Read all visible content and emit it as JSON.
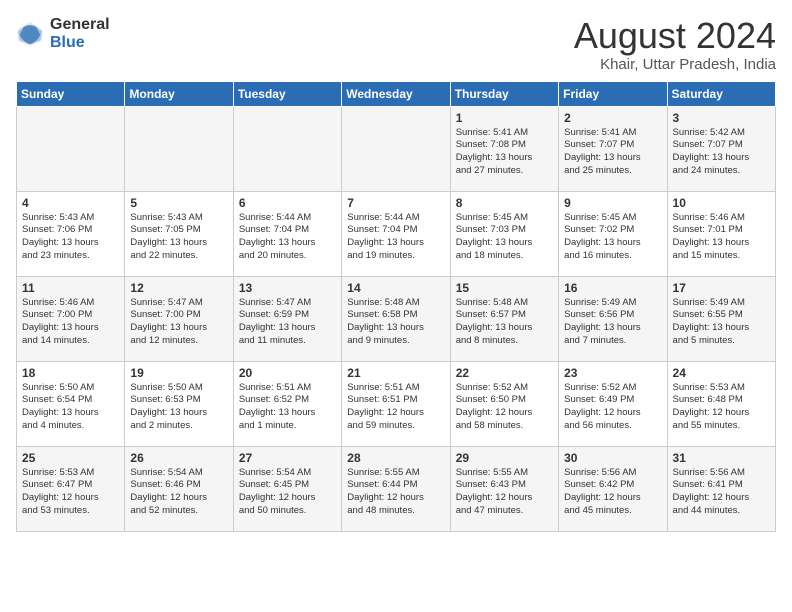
{
  "header": {
    "logo_general": "General",
    "logo_blue": "Blue",
    "month_year": "August 2024",
    "location": "Khair, Uttar Pradesh, India"
  },
  "days_of_week": [
    "Sunday",
    "Monday",
    "Tuesday",
    "Wednesday",
    "Thursday",
    "Friday",
    "Saturday"
  ],
  "weeks": [
    [
      {
        "day": "",
        "text": ""
      },
      {
        "day": "",
        "text": ""
      },
      {
        "day": "",
        "text": ""
      },
      {
        "day": "",
        "text": ""
      },
      {
        "day": "1",
        "text": "Sunrise: 5:41 AM\nSunset: 7:08 PM\nDaylight: 13 hours\nand 27 minutes."
      },
      {
        "day": "2",
        "text": "Sunrise: 5:41 AM\nSunset: 7:07 PM\nDaylight: 13 hours\nand 25 minutes."
      },
      {
        "day": "3",
        "text": "Sunrise: 5:42 AM\nSunset: 7:07 PM\nDaylight: 13 hours\nand 24 minutes."
      }
    ],
    [
      {
        "day": "4",
        "text": "Sunrise: 5:43 AM\nSunset: 7:06 PM\nDaylight: 13 hours\nand 23 minutes."
      },
      {
        "day": "5",
        "text": "Sunrise: 5:43 AM\nSunset: 7:05 PM\nDaylight: 13 hours\nand 22 minutes."
      },
      {
        "day": "6",
        "text": "Sunrise: 5:44 AM\nSunset: 7:04 PM\nDaylight: 13 hours\nand 20 minutes."
      },
      {
        "day": "7",
        "text": "Sunrise: 5:44 AM\nSunset: 7:04 PM\nDaylight: 13 hours\nand 19 minutes."
      },
      {
        "day": "8",
        "text": "Sunrise: 5:45 AM\nSunset: 7:03 PM\nDaylight: 13 hours\nand 18 minutes."
      },
      {
        "day": "9",
        "text": "Sunrise: 5:45 AM\nSunset: 7:02 PM\nDaylight: 13 hours\nand 16 minutes."
      },
      {
        "day": "10",
        "text": "Sunrise: 5:46 AM\nSunset: 7:01 PM\nDaylight: 13 hours\nand 15 minutes."
      }
    ],
    [
      {
        "day": "11",
        "text": "Sunrise: 5:46 AM\nSunset: 7:00 PM\nDaylight: 13 hours\nand 14 minutes."
      },
      {
        "day": "12",
        "text": "Sunrise: 5:47 AM\nSunset: 7:00 PM\nDaylight: 13 hours\nand 12 minutes."
      },
      {
        "day": "13",
        "text": "Sunrise: 5:47 AM\nSunset: 6:59 PM\nDaylight: 13 hours\nand 11 minutes."
      },
      {
        "day": "14",
        "text": "Sunrise: 5:48 AM\nSunset: 6:58 PM\nDaylight: 13 hours\nand 9 minutes."
      },
      {
        "day": "15",
        "text": "Sunrise: 5:48 AM\nSunset: 6:57 PM\nDaylight: 13 hours\nand 8 minutes."
      },
      {
        "day": "16",
        "text": "Sunrise: 5:49 AM\nSunset: 6:56 PM\nDaylight: 13 hours\nand 7 minutes."
      },
      {
        "day": "17",
        "text": "Sunrise: 5:49 AM\nSunset: 6:55 PM\nDaylight: 13 hours\nand 5 minutes."
      }
    ],
    [
      {
        "day": "18",
        "text": "Sunrise: 5:50 AM\nSunset: 6:54 PM\nDaylight: 13 hours\nand 4 minutes."
      },
      {
        "day": "19",
        "text": "Sunrise: 5:50 AM\nSunset: 6:53 PM\nDaylight: 13 hours\nand 2 minutes."
      },
      {
        "day": "20",
        "text": "Sunrise: 5:51 AM\nSunset: 6:52 PM\nDaylight: 13 hours\nand 1 minute."
      },
      {
        "day": "21",
        "text": "Sunrise: 5:51 AM\nSunset: 6:51 PM\nDaylight: 12 hours\nand 59 minutes."
      },
      {
        "day": "22",
        "text": "Sunrise: 5:52 AM\nSunset: 6:50 PM\nDaylight: 12 hours\nand 58 minutes."
      },
      {
        "day": "23",
        "text": "Sunrise: 5:52 AM\nSunset: 6:49 PM\nDaylight: 12 hours\nand 56 minutes."
      },
      {
        "day": "24",
        "text": "Sunrise: 5:53 AM\nSunset: 6:48 PM\nDaylight: 12 hours\nand 55 minutes."
      }
    ],
    [
      {
        "day": "25",
        "text": "Sunrise: 5:53 AM\nSunset: 6:47 PM\nDaylight: 12 hours\nand 53 minutes."
      },
      {
        "day": "26",
        "text": "Sunrise: 5:54 AM\nSunset: 6:46 PM\nDaylight: 12 hours\nand 52 minutes."
      },
      {
        "day": "27",
        "text": "Sunrise: 5:54 AM\nSunset: 6:45 PM\nDaylight: 12 hours\nand 50 minutes."
      },
      {
        "day": "28",
        "text": "Sunrise: 5:55 AM\nSunset: 6:44 PM\nDaylight: 12 hours\nand 48 minutes."
      },
      {
        "day": "29",
        "text": "Sunrise: 5:55 AM\nSunset: 6:43 PM\nDaylight: 12 hours\nand 47 minutes."
      },
      {
        "day": "30",
        "text": "Sunrise: 5:56 AM\nSunset: 6:42 PM\nDaylight: 12 hours\nand 45 minutes."
      },
      {
        "day": "31",
        "text": "Sunrise: 5:56 AM\nSunset: 6:41 PM\nDaylight: 12 hours\nand 44 minutes."
      }
    ]
  ]
}
